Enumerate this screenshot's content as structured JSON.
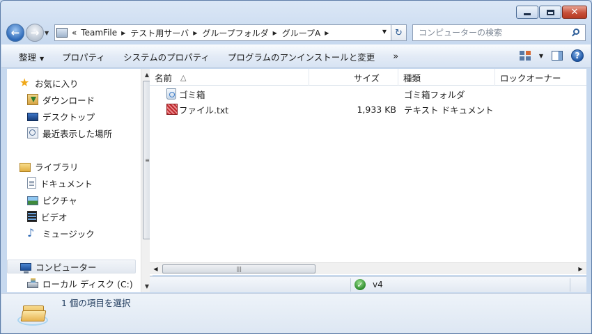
{
  "address": {
    "overflow_glyph": "«",
    "crumbs": [
      "TeamFile",
      "テスト用サーバ",
      "グループフォルダ",
      "グループA"
    ]
  },
  "search": {
    "placeholder": "コンピューターの検索"
  },
  "toolbar": {
    "organize": "整理",
    "properties": "プロパティ",
    "system_properties": "システムのプロパティ",
    "uninstall": "プログラムのアンインストールと変更",
    "more": "»"
  },
  "sidebar": {
    "favorites": {
      "label": "お気に入り",
      "icon": "star-icon"
    },
    "favorite_items": [
      {
        "label": "ダウンロード",
        "icon": "download-folder-icon"
      },
      {
        "label": "デスクトップ",
        "icon": "desktop-icon"
      },
      {
        "label": "最近表示した場所",
        "icon": "recent-places-icon"
      }
    ],
    "libraries": {
      "label": "ライブラリ",
      "icon": "library-icon"
    },
    "library_items": [
      {
        "label": "ドキュメント",
        "icon": "document-icon"
      },
      {
        "label": "ピクチャ",
        "icon": "picture-icon"
      },
      {
        "label": "ビデオ",
        "icon": "video-icon"
      },
      {
        "label": "ミュージック",
        "icon": "music-icon"
      }
    ],
    "computer": {
      "label": "コンピューター",
      "icon": "computer-icon"
    },
    "drive": {
      "label": "ローカル ディスク (C:)",
      "icon": "drive-icon"
    }
  },
  "columns": {
    "name": "名前",
    "size": "サイズ",
    "type": "種類",
    "owner": "ロックオーナー"
  },
  "files": [
    {
      "name": "ゴミ箱",
      "size": "",
      "type": "ゴミ箱フォルダ",
      "icon": "recycle-bin-icon"
    },
    {
      "name": "ファイル.txt",
      "size": "1,933 KB",
      "type": "テキスト ドキュメント",
      "icon": "text-file-icon"
    }
  ],
  "statusbar": {
    "label": "v4"
  },
  "details": {
    "text": "1 個の項目を選択"
  },
  "colors": {
    "accent": "#2d69b8",
    "close": "#c7503a",
    "window_frame": "#c9d9ee"
  }
}
